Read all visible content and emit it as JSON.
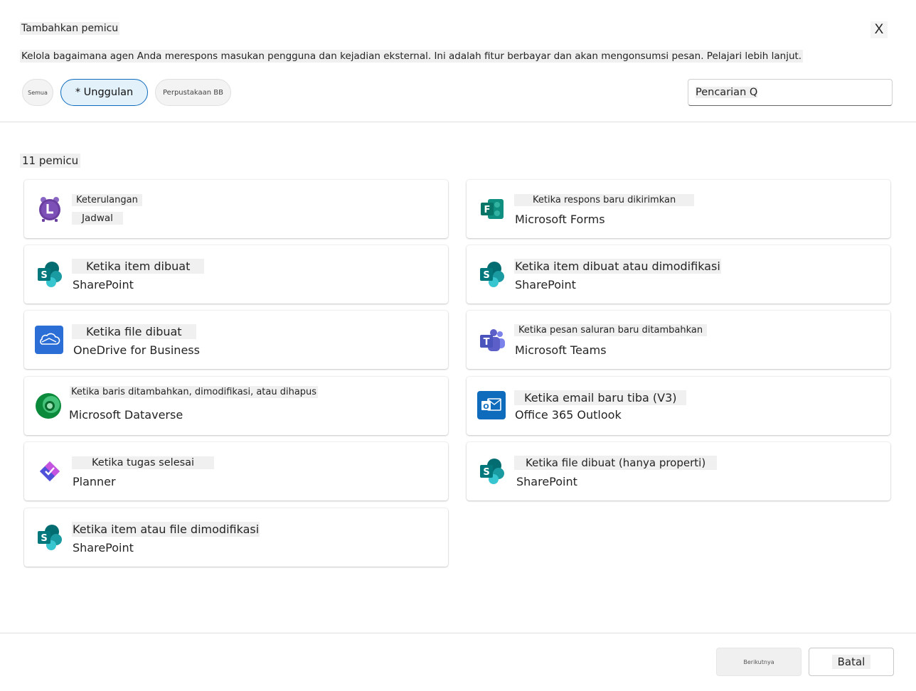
{
  "dialog": {
    "title": "Tambahkan pemicu",
    "close_label": "X",
    "description": "Kelola bagaimana agen Anda merespons masukan pengguna dan kejadian eksternal. Ini adalah fitur berbayar dan akan mengonsumsi pesan. Pelajari lebih lanjut."
  },
  "filters": {
    "all": "Semua",
    "featured": "* Unggulan",
    "library": "Perpustakaan BB"
  },
  "search": {
    "placeholder": "Pencarian Q"
  },
  "count_label": "11 pemicu",
  "triggers": [
    {
      "trigger": "Keterulangan",
      "connector": "Jadwal",
      "icon": "alarm-clock-icon"
    },
    {
      "trigger": "Ketika respons baru dikirimkan",
      "connector": "Microsoft Forms",
      "icon": "forms-icon"
    },
    {
      "trigger": "Ketika item dibuat",
      "connector": "SharePoint",
      "icon": "sharepoint-icon"
    },
    {
      "trigger": "Ketika item dibuat atau dimodifikasi",
      "connector": "SharePoint",
      "icon": "sharepoint-icon"
    },
    {
      "trigger": "Ketika file dibuat",
      "connector": "OneDrive for Business",
      "icon": "onedrive-icon"
    },
    {
      "trigger": "Ketika pesan saluran baru ditambahkan",
      "connector": "Microsoft Teams",
      "icon": "teams-icon"
    },
    {
      "trigger": "Ketika baris ditambahkan, dimodifikasi, atau dihapus",
      "connector": "Microsoft Dataverse",
      "icon": "dataverse-icon"
    },
    {
      "trigger": "Ketika email baru tiba (V3)",
      "connector": "Office 365 Outlook",
      "icon": "outlook-icon"
    },
    {
      "trigger": "Ketika tugas selesai",
      "connector": "Planner",
      "icon": "planner-icon"
    },
    {
      "trigger": "Ketika file dibuat (hanya properti)",
      "connector": "SharePoint",
      "icon": "sharepoint-icon"
    },
    {
      "trigger": "Ketika item atau file dimodifikasi",
      "connector": "SharePoint",
      "icon": "sharepoint-icon"
    }
  ],
  "footer": {
    "next": "Berikutnya",
    "cancel": "Batal"
  },
  "colors": {
    "accent": "#0f6cbd",
    "featured_bg": "#e3f1fb",
    "sharepoint": "#036c70",
    "teams": "#5b5fc7",
    "outlook": "#0f6cbd",
    "forms": "#077568",
    "schedule": "#6b3fa0"
  }
}
